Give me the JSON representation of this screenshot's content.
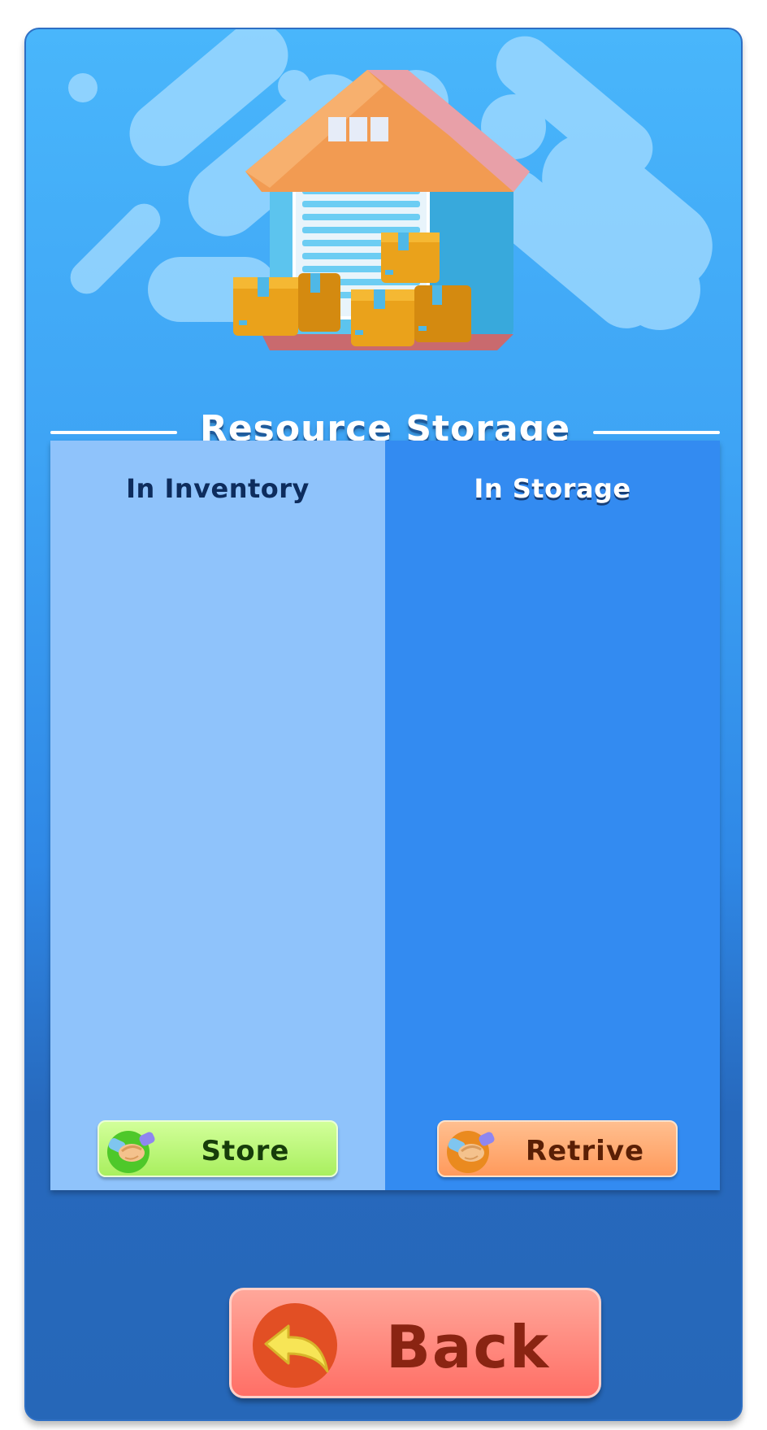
{
  "title": "Resource Storage",
  "columns": {
    "inventory": {
      "title": "In Inventory",
      "button_label": "Store",
      "button_icon": "handshake-icon"
    },
    "storage": {
      "title": "In Storage",
      "button_label": "Retrive",
      "button_icon": "handshake-icon"
    }
  },
  "back_button": {
    "label": "Back",
    "icon": "back-arrow-icon"
  },
  "hero_icon": "warehouse-icon",
  "colors": {
    "panel_top": "#49b6fb",
    "panel_bottom": "#2667b8",
    "inventory_bg": "#8fc3fb",
    "storage_bg": "#338bf1",
    "store_button": "#b8f56e",
    "retrive_button": "#ffa86f",
    "back_button": "#ff8a80"
  }
}
